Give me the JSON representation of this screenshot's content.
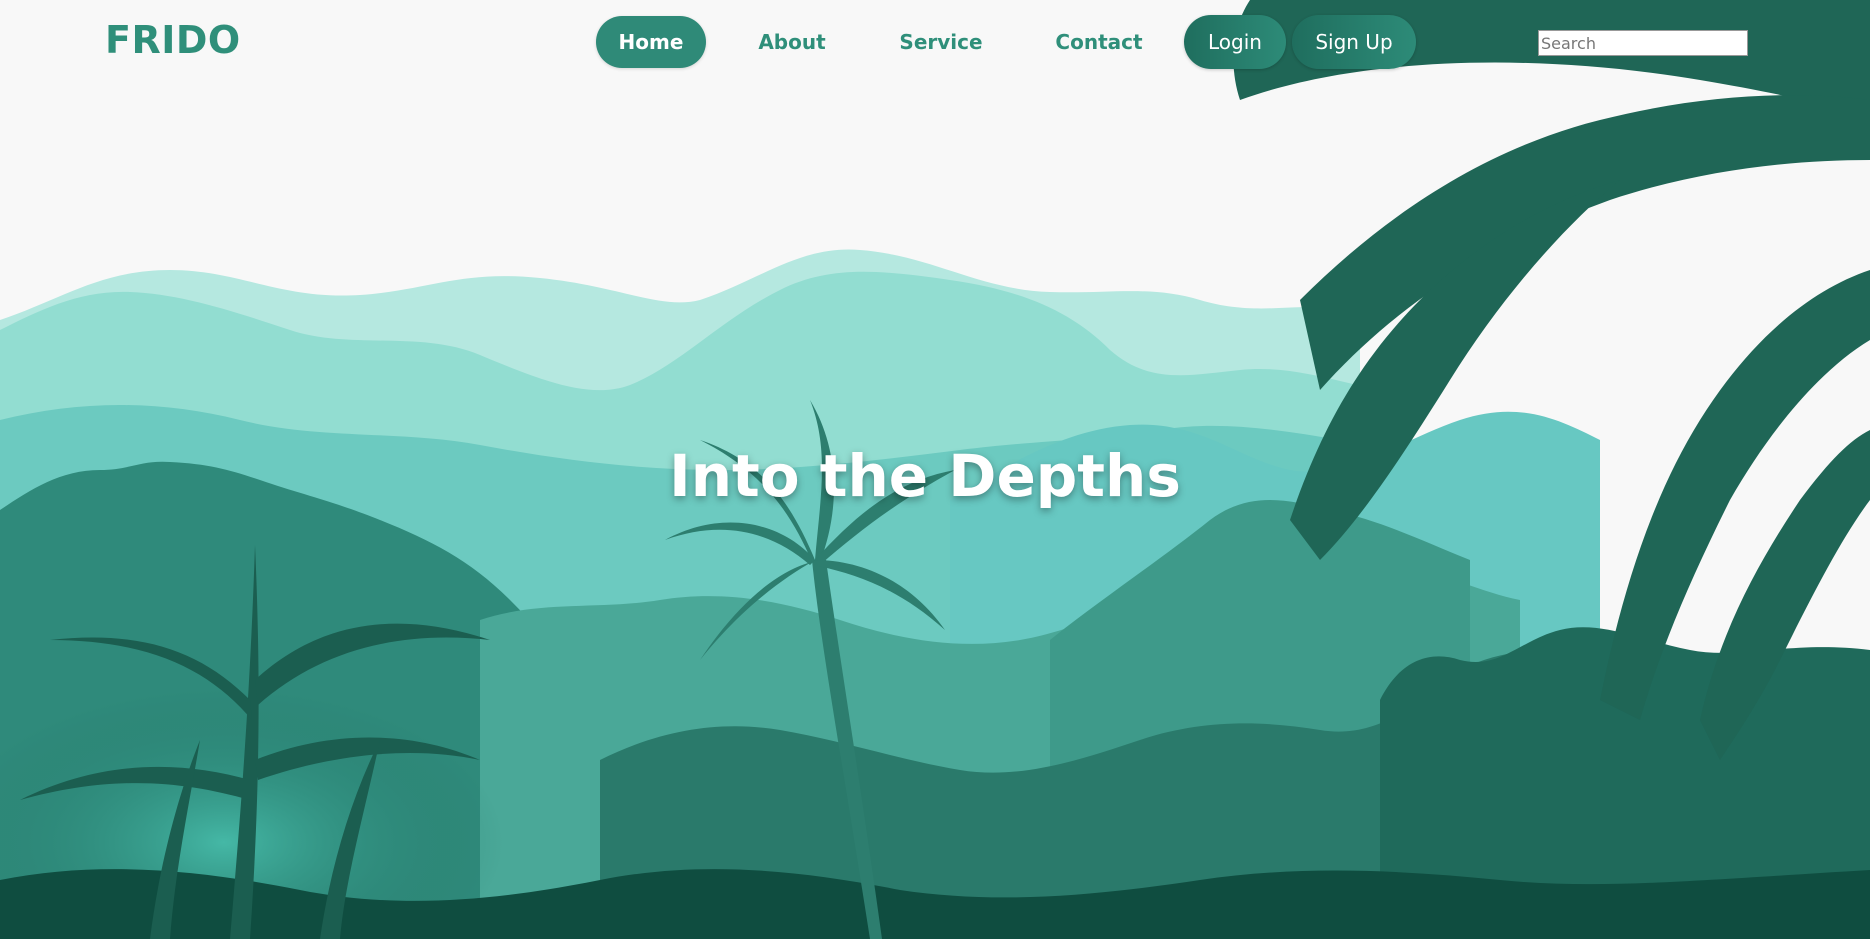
{
  "brand": {
    "logo_text": "FRIDO"
  },
  "nav": {
    "links": [
      {
        "label": "Home",
        "active": true
      },
      {
        "label": "About",
        "active": false
      },
      {
        "label": "Service",
        "active": false
      },
      {
        "label": "Contact",
        "active": false
      }
    ],
    "login_label": "Login",
    "signup_label": "Sign Up"
  },
  "search": {
    "placeholder": "Search",
    "value": ""
  },
  "hero": {
    "title": "Into the Depths"
  },
  "colors": {
    "brand": "#2f8f7a",
    "active_pill": "#2f8a78",
    "button_gradient_start": "#1f6e5e",
    "button_gradient_end": "#2d8b78",
    "sky": "#f8f8f8",
    "far_hills": "#b5e8e0",
    "mid_hills": "#92ddd1",
    "near_hills": "#5fbdb0",
    "forest": "#3b9c8c",
    "dark_forest": "#24705f",
    "foreground": "#0f4d40"
  }
}
